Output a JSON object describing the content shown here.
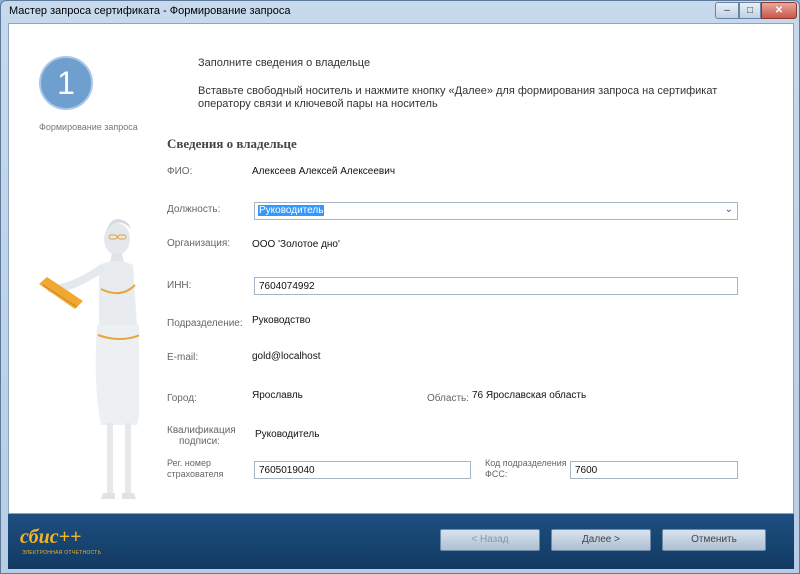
{
  "window": {
    "title": "Мастер запроса сертификата - Формирование запроса",
    "min_glyph": "‒",
    "max_glyph": "□",
    "close_glyph": "✕"
  },
  "step": {
    "number": "1",
    "label": "Формирование запроса"
  },
  "info": {
    "heading": "Заполните сведения о владельце",
    "text": "Вставьте свободный носитель и нажмите кнопку «Далее» для формирования запроса на сертификат оператору связи и ключевой пары на носитель"
  },
  "form": {
    "section_title": "Сведения о владельце",
    "fio_label": "ФИО:",
    "fio_value": "Алексеев Алексей Алексеевич",
    "position_label": "Должность:",
    "position_value": "Руководитель",
    "org_label": "Организация:",
    "org_value": "ООО 'Золотое дно'",
    "inn_label": "ИНН:",
    "inn_value": "7604074992",
    "dept_label": "Подразделение:",
    "dept_value": "Руководство",
    "email_label": "E-mail:",
    "email_value": "gold@localhost",
    "city_label": "Город:",
    "city_value": "Ярославль",
    "region_label": "Область:",
    "region_value": "76 Ярославская область",
    "qual_label_1": "Квалификация",
    "qual_label_2": "подписи:",
    "qual_value": "Руководитель",
    "regnum_label_1": "Рег. номер",
    "regnum_label_2": "страхователя",
    "regnum_value": "7605019040",
    "fss_label_1": "Код подразделения",
    "fss_label_2": "ФСС:",
    "fss_value": "7600"
  },
  "footer": {
    "logo": "сбис++",
    "logo_sub": "ЭЛЕКТРОННАЯ ОТЧЕТНОСТЬ",
    "back": "< Назад",
    "next": "Далее >",
    "cancel": "Отменить"
  },
  "colors": {
    "accent": "#123a63",
    "logo": "#f0b429",
    "selection": "#3399ff"
  }
}
